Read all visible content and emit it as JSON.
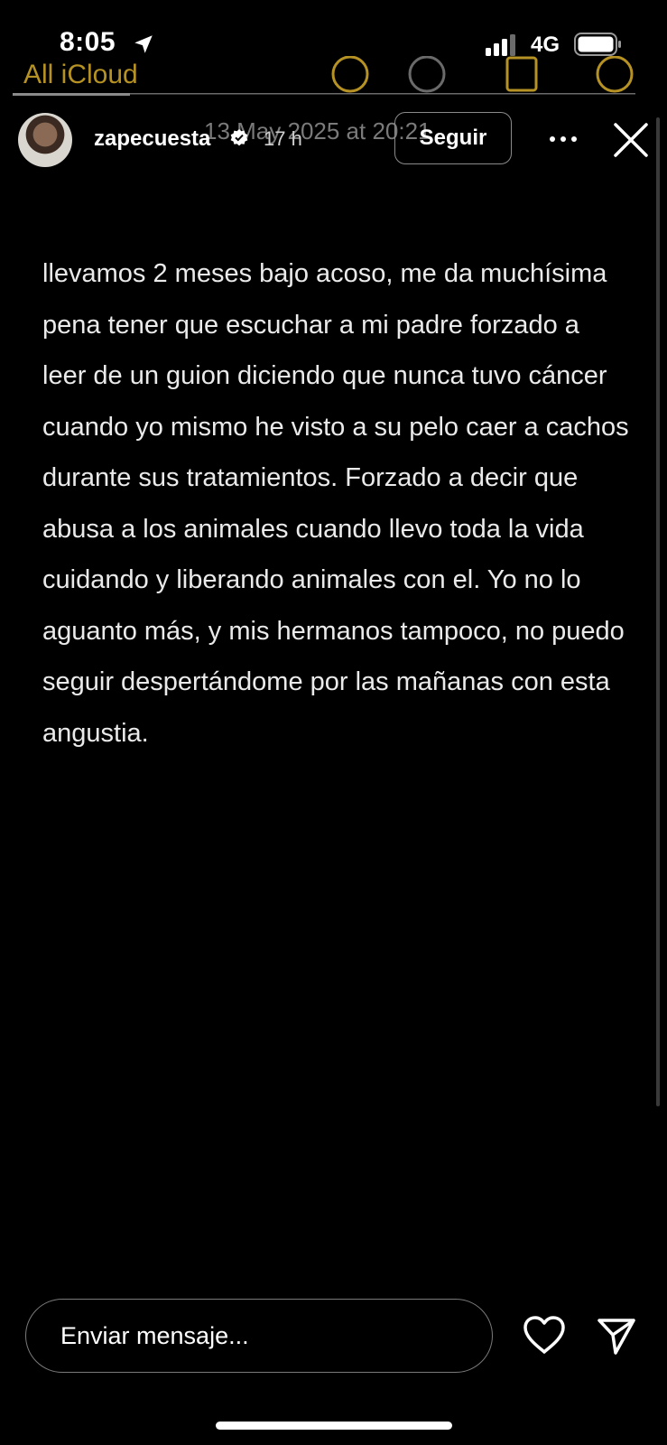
{
  "status_bar": {
    "time": "8:05",
    "network": "4G",
    "icons": [
      "location-arrow-icon",
      "signal-bars-icon",
      "battery-icon"
    ]
  },
  "background_app": {
    "back_label": "All iCloud",
    "date": "13 May 2025 at 20:21",
    "accent": "#c9a227"
  },
  "story_header": {
    "username": "zapecuesta",
    "verified": true,
    "time_ago": "17 h",
    "follow_label": "Seguir",
    "icons": [
      "verified-badge-icon",
      "more-options-icon",
      "close-icon"
    ]
  },
  "story_body": {
    "text": "llevamos 2 meses bajo acoso, me da muchísima pena tener que escuchar a mi padre forzado a leer de un guion diciendo que nunca tuvo cáncer cuando yo mismo he visto a su pelo caer a cachos durante sus tratamientos. Forzado a decir que abusa a los animales cuando llevo toda la vida cuidando y liberando animales con el. Yo no lo aguanto más, y mis hermanos tampoco, no puedo seguir despertándome por las mañanas con esta angustia."
  },
  "reply_bar": {
    "placeholder": "Enviar mensaje...",
    "icons": [
      "heart-icon",
      "send-icon"
    ]
  },
  "colors": {
    "background": "#000000",
    "text": "#ffffff",
    "border": "#7a7a7a"
  }
}
